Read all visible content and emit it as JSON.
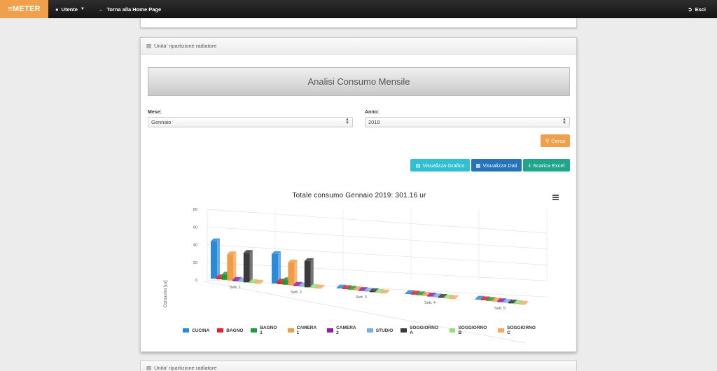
{
  "navbar": {
    "brand": "≡METER",
    "user_label": "Utente",
    "home_label": "Torna alla Home Page",
    "logout_label": "Esci"
  },
  "panel": {
    "heading": "Unita' ripartizione radiatore",
    "title": "Analisi Consumo Mensile",
    "mese_label": "Mese:",
    "mese_value": "Gennaio",
    "anno_label": "Anno:",
    "anno_value": "2019",
    "cerca_label": "Cerca",
    "grafico_label": "Visualizza Grafico",
    "dati_label": "Visualizza Dati",
    "excel_label": "Scarica Excel"
  },
  "panel_bottom": {
    "heading": "Unita' ripartizione radiatore"
  },
  "colors": {
    "navbar_brand": "#f0a04b",
    "btn_cerca": "#f0a04b",
    "btn_grafico": "#30c0d0",
    "btn_dati": "#2573b8",
    "btn_excel": "#1fa58a"
  },
  "chart_data": {
    "type": "bar",
    "title": "Totale consumo Gennaio 2019: 301.16 ur",
    "ylabel": "Consumo [ur]",
    "ylim": [
      0,
      80
    ],
    "yticks": [
      0,
      20,
      40,
      60,
      80
    ],
    "categories": [
      "Sett. 1",
      "Sett. 2",
      "Sett. 3",
      "Sett. 4",
      "Sett. 5"
    ],
    "series": [
      {
        "name": "CUCINA",
        "color": "#2b8ad8",
        "values": [
          57,
          45,
          0,
          0,
          0
        ]
      },
      {
        "name": "BAGNO",
        "color": "#e0242a",
        "values": [
          3,
          4,
          0,
          0,
          0
        ]
      },
      {
        "name": "BAGNO 1",
        "color": "#1e9a3a",
        "values": [
          8,
          7,
          0,
          0,
          0
        ]
      },
      {
        "name": "CAMERA 1",
        "color": "#f39a44",
        "values": [
          40,
          35,
          0,
          0,
          0
        ]
      },
      {
        "name": "CAMERA 2",
        "color": "#8e1fa0",
        "values": [
          2,
          2,
          0,
          0,
          0
        ]
      },
      {
        "name": "STUDIO",
        "color": "#7aaee8",
        "values": [
          2,
          2,
          0,
          0,
          0
        ]
      },
      {
        "name": "SOGGIORNO A",
        "color": "#3a3a3a",
        "values": [
          45,
          40,
          0,
          0,
          0
        ]
      },
      {
        "name": "SOGGIORNO B",
        "color": "#8ee27a",
        "values": [
          1,
          1,
          0,
          0,
          0
        ]
      },
      {
        "name": "SOGGIORNO C",
        "color": "#f5a965",
        "values": [
          1,
          1,
          0,
          0,
          0
        ]
      }
    ]
  }
}
